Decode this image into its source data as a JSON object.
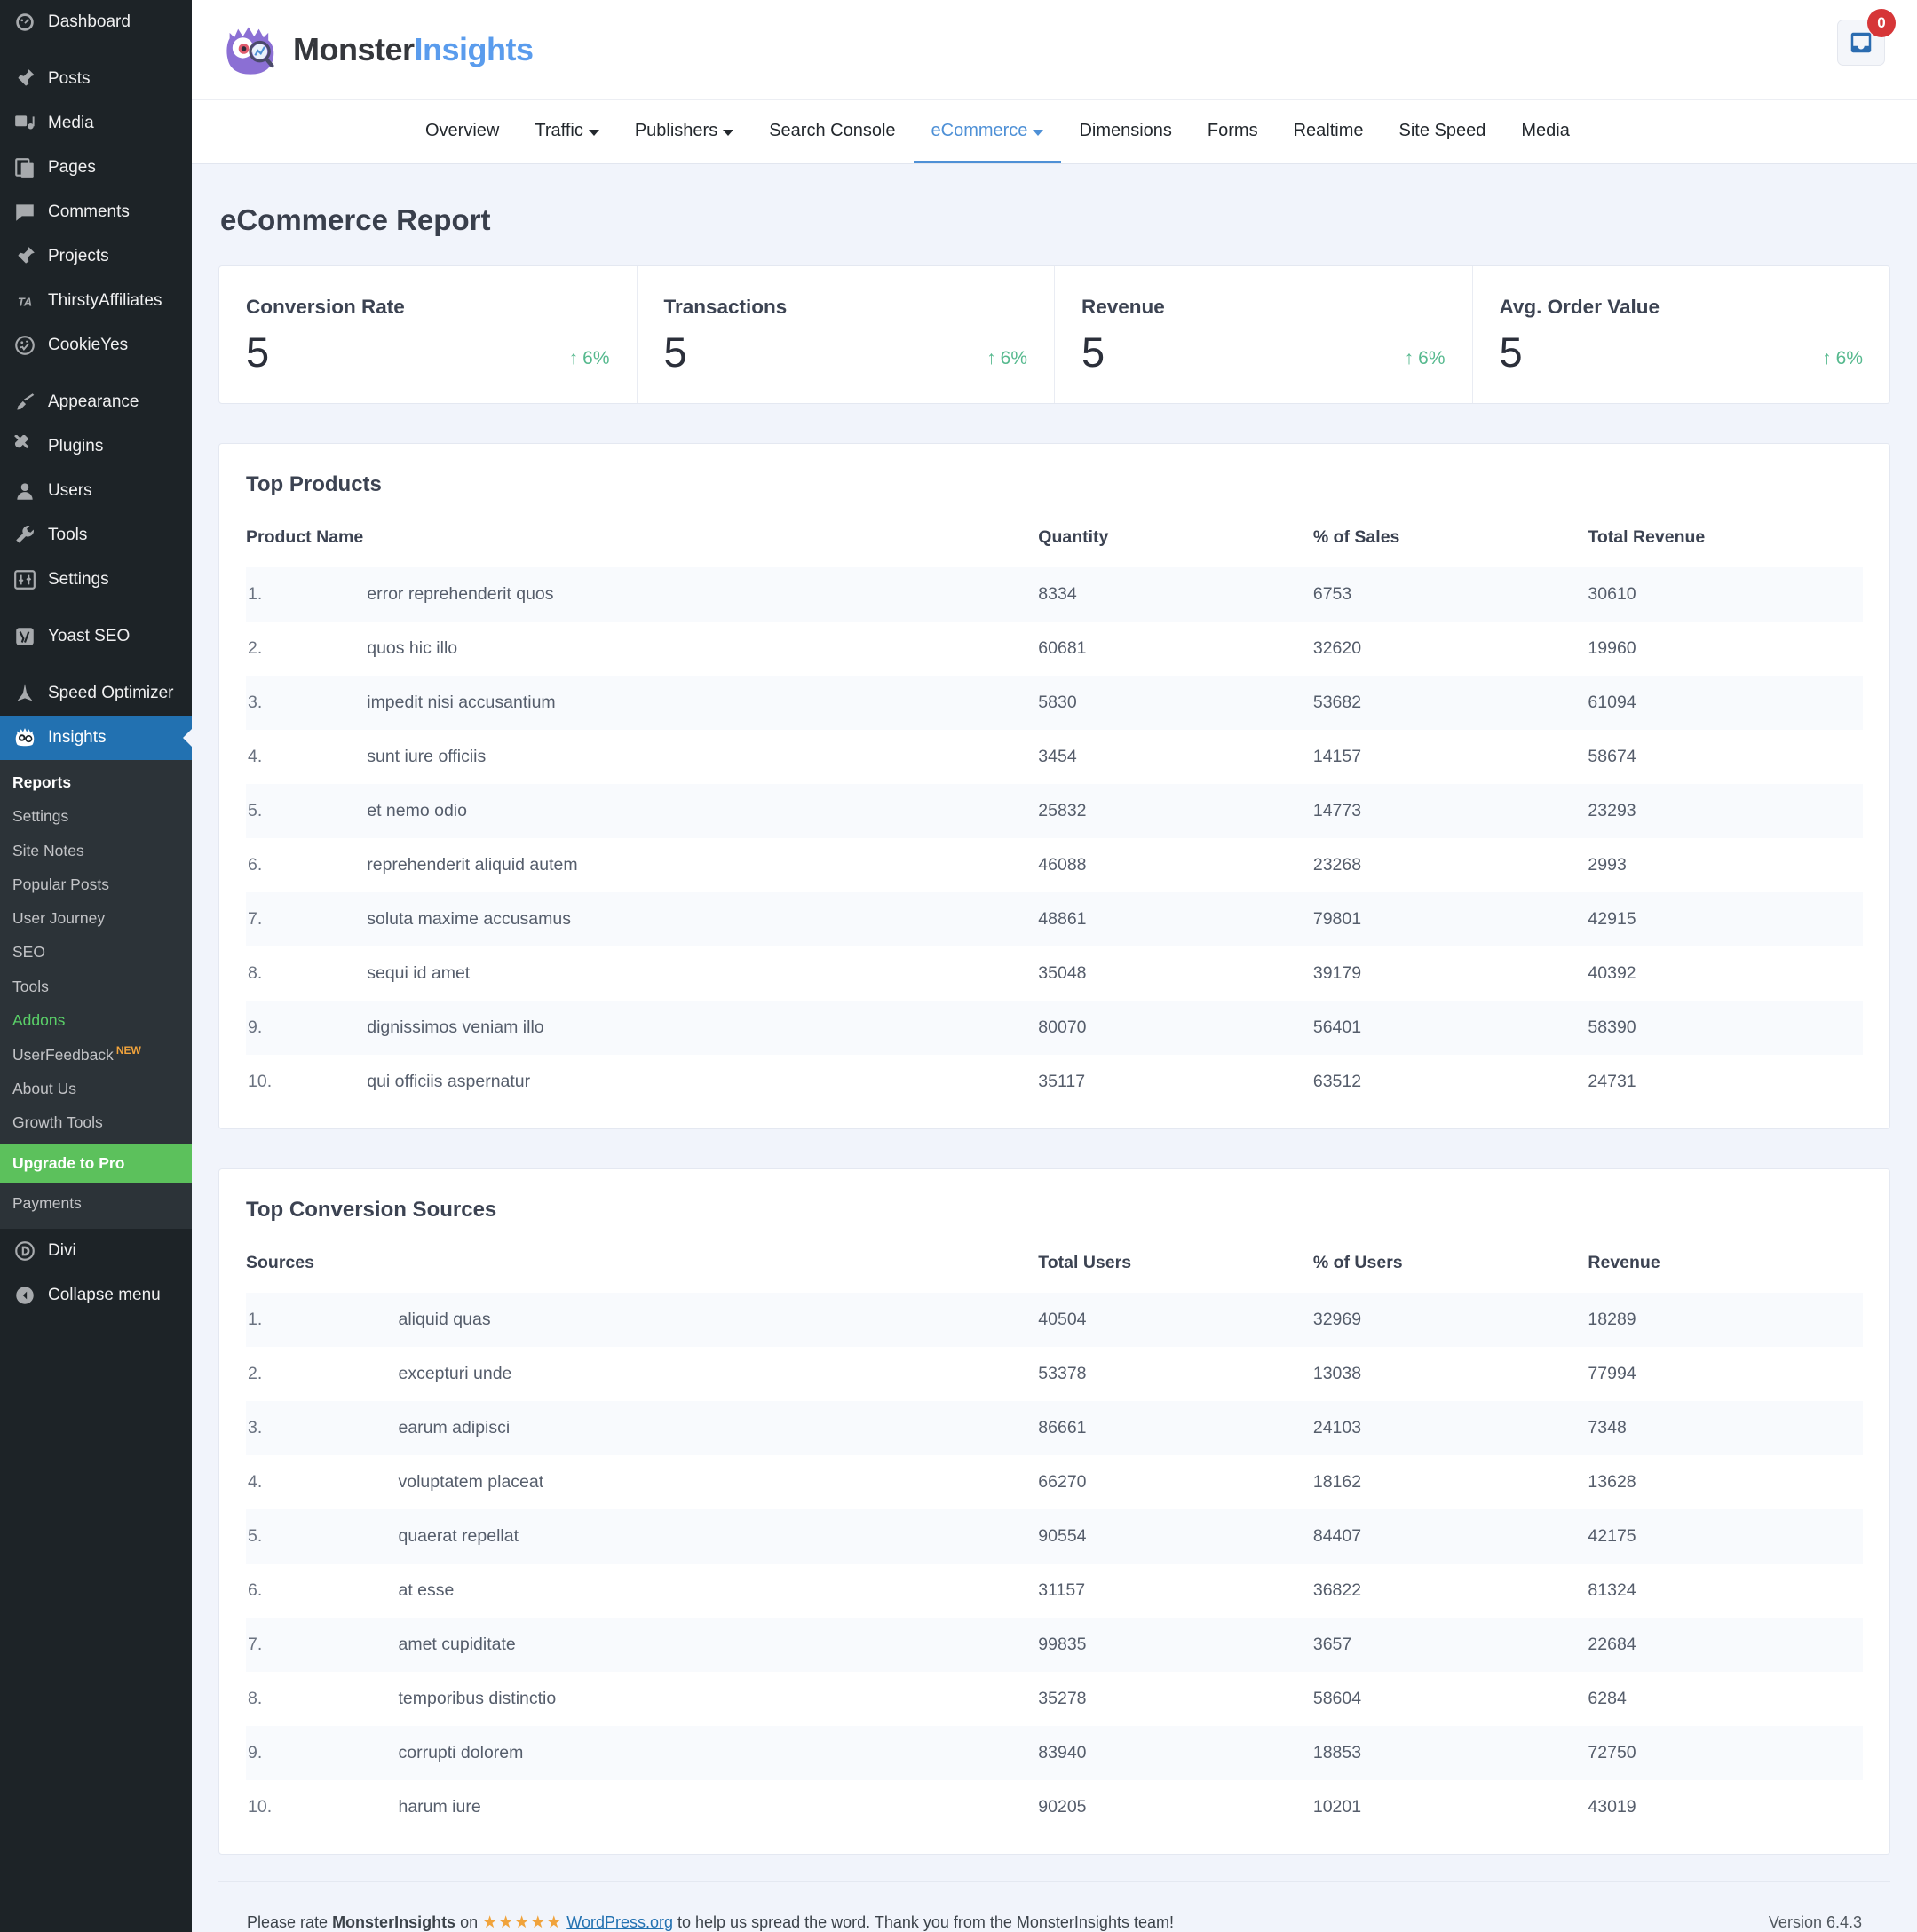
{
  "sidebar": {
    "wp_items": [
      {
        "label": "Dashboard",
        "icon": "dashboard-icon"
      },
      {
        "label": "Posts",
        "icon": "pin-icon"
      },
      {
        "label": "Media",
        "icon": "media-icon"
      },
      {
        "label": "Pages",
        "icon": "pages-icon"
      },
      {
        "label": "Comments",
        "icon": "comments-icon"
      },
      {
        "label": "Projects",
        "icon": "pin-icon"
      },
      {
        "label": "ThirstyAffiliates",
        "icon": "thirstyaffiliates-icon"
      },
      {
        "label": "CookieYes",
        "icon": "cookieyes-icon"
      },
      {
        "label": "Appearance",
        "icon": "paintbrush-icon"
      },
      {
        "label": "Plugins",
        "icon": "plug-icon"
      },
      {
        "label": "Users",
        "icon": "user-icon"
      },
      {
        "label": "Tools",
        "icon": "wrench-icon"
      },
      {
        "label": "Settings",
        "icon": "settings-sliders-icon"
      },
      {
        "label": "Yoast SEO",
        "icon": "yoast-icon"
      },
      {
        "label": "Speed Optimizer",
        "icon": "speed-optimizer-icon"
      },
      {
        "label": "Insights",
        "icon": "monsterinsights-icon"
      }
    ],
    "submenu": [
      {
        "label": "Reports",
        "state": "current"
      },
      {
        "label": "Settings",
        "state": "normal"
      },
      {
        "label": "Site Notes",
        "state": "normal"
      },
      {
        "label": "Popular Posts",
        "state": "normal"
      },
      {
        "label": "User Journey",
        "state": "normal"
      },
      {
        "label": "SEO",
        "state": "normal"
      },
      {
        "label": "Tools",
        "state": "normal"
      },
      {
        "label": "Addons",
        "state": "addons"
      },
      {
        "label": "UserFeedback",
        "state": "normal",
        "badge": "NEW"
      },
      {
        "label": "About Us",
        "state": "normal"
      },
      {
        "label": "Growth Tools",
        "state": "normal"
      },
      {
        "label": "Upgrade to Pro",
        "state": "upgrade"
      },
      {
        "label": "Payments",
        "state": "normal"
      }
    ],
    "bottom_items": [
      {
        "label": "Divi",
        "icon": "divi-icon"
      },
      {
        "label": "Collapse menu",
        "icon": "collapse-icon"
      }
    ]
  },
  "header": {
    "brand_first": "Monster",
    "brand_second": "Insights",
    "notification_count": "0"
  },
  "nav": {
    "items": [
      {
        "label": "Overview",
        "caret": false,
        "active": false
      },
      {
        "label": "Traffic",
        "caret": true,
        "active": false
      },
      {
        "label": "Publishers",
        "caret": true,
        "active": false
      },
      {
        "label": "Search Console",
        "caret": false,
        "active": false
      },
      {
        "label": "eCommerce",
        "caret": true,
        "active": true
      },
      {
        "label": "Dimensions",
        "caret": false,
        "active": false
      },
      {
        "label": "Forms",
        "caret": false,
        "active": false
      },
      {
        "label": "Realtime",
        "caret": false,
        "active": false
      },
      {
        "label": "Site Speed",
        "caret": false,
        "active": false
      },
      {
        "label": "Media",
        "caret": false,
        "active": false
      }
    ]
  },
  "page": {
    "title": "eCommerce Report"
  },
  "stats": [
    {
      "label": "Conversion Rate",
      "value": "5",
      "delta": "6%",
      "direction": "up"
    },
    {
      "label": "Transactions",
      "value": "5",
      "delta": "6%",
      "direction": "up"
    },
    {
      "label": "Revenue",
      "value": "5",
      "delta": "6%",
      "direction": "up"
    },
    {
      "label": "Avg. Order Value",
      "value": "5",
      "delta": "6%",
      "direction": "up"
    }
  ],
  "top_products": {
    "title": "Top Products",
    "columns": [
      "Product Name",
      "Quantity",
      "% of Sales",
      "Total Revenue"
    ],
    "rows": [
      {
        "idx": "1.",
        "name": "error reprehenderit quos",
        "quantity": "8334",
        "pct": "6753",
        "revenue": "30610"
      },
      {
        "idx": "2.",
        "name": "quos hic illo",
        "quantity": "60681",
        "pct": "32620",
        "revenue": "19960"
      },
      {
        "idx": "3.",
        "name": "impedit nisi accusantium",
        "quantity": "5830",
        "pct": "53682",
        "revenue": "61094"
      },
      {
        "idx": "4.",
        "name": "sunt iure officiis",
        "quantity": "3454",
        "pct": "14157",
        "revenue": "58674"
      },
      {
        "idx": "5.",
        "name": "et nemo odio",
        "quantity": "25832",
        "pct": "14773",
        "revenue": "23293"
      },
      {
        "idx": "6.",
        "name": "reprehenderit aliquid autem",
        "quantity": "46088",
        "pct": "23268",
        "revenue": "2993"
      },
      {
        "idx": "7.",
        "name": "soluta maxime accusamus",
        "quantity": "48861",
        "pct": "79801",
        "revenue": "42915"
      },
      {
        "idx": "8.",
        "name": "sequi id amet",
        "quantity": "35048",
        "pct": "39179",
        "revenue": "40392"
      },
      {
        "idx": "9.",
        "name": "dignissimos veniam illo",
        "quantity": "80070",
        "pct": "56401",
        "revenue": "58390"
      },
      {
        "idx": "10.",
        "name": "qui officiis aspernatur",
        "quantity": "35117",
        "pct": "63512",
        "revenue": "24731"
      }
    ]
  },
  "top_sources": {
    "title": "Top Conversion Sources",
    "columns": [
      "Sources",
      "Total Users",
      "% of Users",
      "Revenue"
    ],
    "rows": [
      {
        "idx": "1.",
        "name": "aliquid quas",
        "users": "40504",
        "pct": "32969",
        "revenue": "18289"
      },
      {
        "idx": "2.",
        "name": "excepturi unde",
        "users": "53378",
        "pct": "13038",
        "revenue": "77994"
      },
      {
        "idx": "3.",
        "name": "earum adipisci",
        "users": "86661",
        "pct": "24103",
        "revenue": "7348"
      },
      {
        "idx": "4.",
        "name": "voluptatem placeat",
        "users": "66270",
        "pct": "18162",
        "revenue": "13628"
      },
      {
        "idx": "5.",
        "name": "quaerat repellat",
        "users": "90554",
        "pct": "84407",
        "revenue": "42175"
      },
      {
        "idx": "6.",
        "name": "at esse",
        "users": "31157",
        "pct": "36822",
        "revenue": "81324"
      },
      {
        "idx": "7.",
        "name": "amet cupiditate",
        "users": "99835",
        "pct": "3657",
        "revenue": "22684"
      },
      {
        "idx": "8.",
        "name": "temporibus distinctio",
        "users": "35278",
        "pct": "58604",
        "revenue": "6284"
      },
      {
        "idx": "9.",
        "name": "corrupti dolorem",
        "users": "83940",
        "pct": "18853",
        "revenue": "72750"
      },
      {
        "idx": "10.",
        "name": "harum iure",
        "users": "90205",
        "pct": "10201",
        "revenue": "43019"
      }
    ]
  },
  "footer": {
    "text_before": "Please rate ",
    "brand": "MonsterInsights",
    "text_on": " on ",
    "stars": "★★★★★",
    "link": "WordPress.org",
    "text_after": " to help us spread the word. Thank you from the MonsterInsights team!",
    "version": "Version 6.4.3"
  },
  "colors": {
    "accent": "#4e90d6",
    "sidebar_active": "#2271b1",
    "upgrade_green": "#5cc15c",
    "addons_green": "#5ad068",
    "delta_green": "#56b98e",
    "badge_red": "#d63638",
    "star_orange": "#f0a33c"
  }
}
